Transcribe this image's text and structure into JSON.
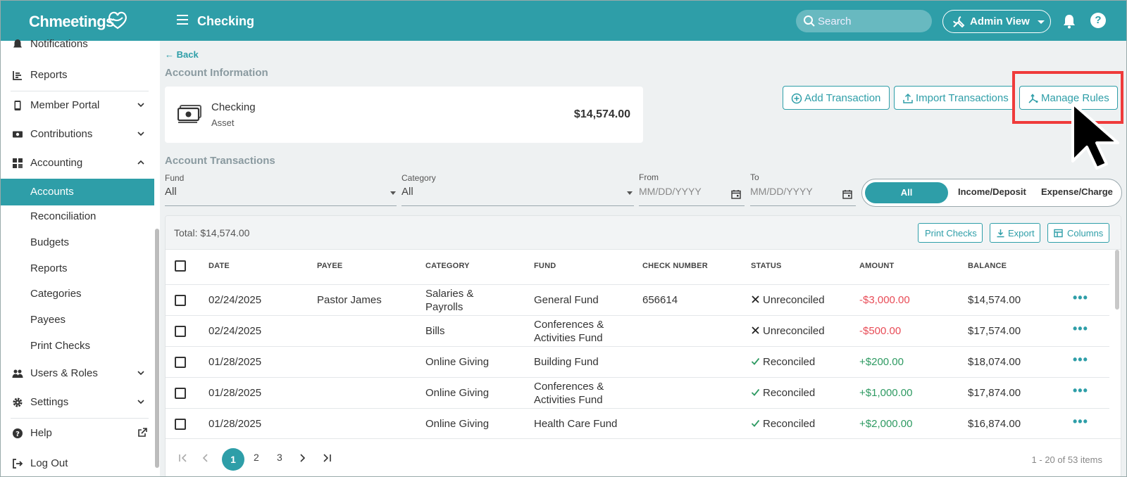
{
  "app": {
    "logo_text": "Chmeetings",
    "page_title": "Checking",
    "search_placeholder": "Search",
    "admin_view_label": "Admin View"
  },
  "sidebar": {
    "items": [
      {
        "label": "Notifications",
        "icon": "bell-icon"
      },
      {
        "label": "Reports",
        "icon": "bar-chart-icon"
      },
      {
        "label": "Member Portal",
        "icon": "phone-icon"
      },
      {
        "label": "Contributions",
        "icon": "money-icon"
      },
      {
        "label": "Accounting",
        "icon": "grid-icon"
      },
      {
        "label": "Accounts",
        "icon": "",
        "active": true
      },
      {
        "label": "Reconciliation"
      },
      {
        "label": "Budgets"
      },
      {
        "label": "Reports"
      },
      {
        "label": "Categories"
      },
      {
        "label": "Payees"
      },
      {
        "label": "Print Checks"
      },
      {
        "label": "Users & Roles",
        "icon": "users-icon"
      },
      {
        "label": "Settings",
        "icon": "gear-icon"
      },
      {
        "label": "Help",
        "icon": "help-icon"
      },
      {
        "label": "Log Out",
        "icon": "logout-icon"
      }
    ]
  },
  "main": {
    "back_label": "Back",
    "account_info_title": "Account Information",
    "account": {
      "name": "Checking",
      "type": "Asset",
      "balance": "$14,574.00"
    },
    "actions": {
      "add_transaction": "Add Transaction",
      "import_transactions": "Import Transactions",
      "manage_rules": "Manage Rules"
    },
    "transactions_title": "Account Transactions",
    "filters": {
      "fund_label": "Fund",
      "fund_value": "All",
      "category_label": "Category",
      "category_value": "All",
      "from_label": "From",
      "from_placeholder": "MM/DD/YYYY",
      "to_label": "To",
      "to_placeholder": "MM/DD/YYYY",
      "type_options": [
        "All",
        "Income/Deposit",
        "Expense/Charge"
      ],
      "type_selected": "All"
    },
    "table": {
      "total_label": "Total:",
      "total_value": "$14,574.00",
      "print_checks": "Print Checks",
      "export": "Export",
      "columns": "Columns",
      "headers": [
        "DATE",
        "PAYEE",
        "CATEGORY",
        "FUND",
        "CHECK NUMBER",
        "STATUS",
        "AMOUNT",
        "BALANCE"
      ],
      "rows": [
        {
          "date": "02/24/2025",
          "payee": "Pastor James",
          "category": "Salaries & Payrolls",
          "fund": "General Fund",
          "check": "656614",
          "status": "Unreconciled",
          "amount": "-$3,000.00",
          "balance": "$14,574.00"
        },
        {
          "date": "02/24/2025",
          "payee": "",
          "category": "Bills",
          "fund": "Conferences & Activities Fund",
          "check": "",
          "status": "Unreconciled",
          "amount": "-$500.00",
          "balance": "$17,574.00"
        },
        {
          "date": "01/28/2025",
          "payee": "",
          "category": "Online Giving",
          "fund": "Building Fund",
          "check": "",
          "status": "Reconciled",
          "amount": "+$200.00",
          "balance": "$18,074.00"
        },
        {
          "date": "01/28/2025",
          "payee": "",
          "category": "Online Giving",
          "fund": "Conferences & Activities Fund",
          "check": "",
          "status": "Reconciled",
          "amount": "+$1,000.00",
          "balance": "$17,874.00"
        },
        {
          "date": "01/28/2025",
          "payee": "",
          "category": "Online Giving",
          "fund": "Health Care Fund",
          "check": "",
          "status": "Reconciled",
          "amount": "+$2,000.00",
          "balance": "$16,874.00"
        }
      ]
    },
    "pagination": {
      "pages": [
        "1",
        "2",
        "3"
      ],
      "current": "1",
      "info": "1 - 20 of 53 items"
    }
  },
  "colors": {
    "brand": "#2e9ea8",
    "negative": "#e84c57",
    "positive": "#2e9a62",
    "highlight": "#ef3b3b"
  }
}
